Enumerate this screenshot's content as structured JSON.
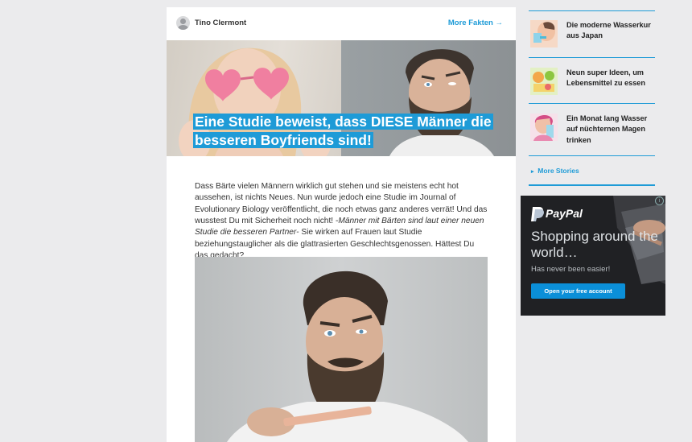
{
  "article": {
    "author": "Tino Clermont",
    "more_link": "More Fakten →",
    "title": "Eine Studie beweist, dass DIESE Männer die besseren Boyfriends sind!",
    "body_part1": "Dass Bärte vielen Männern wirklich gut stehen und sie meistens echt hot aussehen, ist nichts Neues. Nun wurde jedoch eine Studie im Journal of Evolutionary Biology veröffentlicht, die noch etwas ganz anderes verrät! Und das wusstest Du mit Sicherheit noch nicht! -",
    "body_quote": "Männer mit Bärten sind laut einer neuen Studie die besseren Partner-",
    "body_part2": " Sie wirken auf Frauen laut Studie beziehungstauglicher als die glattrasierten Geschlechtsgenossen. Hättest Du das gedacht?"
  },
  "sidebar": {
    "items": [
      {
        "title": "Die moderne Wasserkur aus Japan"
      },
      {
        "title": "Neun super Ideen, um Lebensmittel zu essen"
      },
      {
        "title": "Ein Monat lang Wasser auf nüchternen Magen trinken"
      }
    ],
    "more_stories": "More Stories"
  },
  "ad": {
    "brand": "PayPal",
    "headline": "Shopping around the world…",
    "subline": "Has never been easier!",
    "cta": "Open your free account",
    "info": "i"
  },
  "colors": {
    "accent": "#1e9bd7",
    "background": "#ebebed",
    "ad_background": "#202124"
  }
}
